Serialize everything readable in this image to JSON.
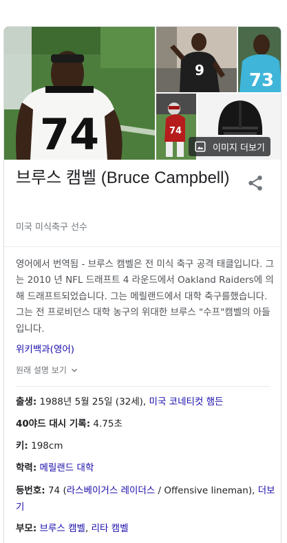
{
  "images": {
    "more_label": "이미지 더보기",
    "main_jersey": "74",
    "a_jersey": "9",
    "b_jersey": "73",
    "c_jersey": "74"
  },
  "header": {
    "title": "브루스 캠벨 (Bruce Campbell)",
    "subtitle": "미국 미식축구 선수"
  },
  "description": {
    "source_label": "영어에서 번역됨 - ",
    "text": "브루스 캠벨은 전 미식 축구 공격 태클입니다. 그는 2010 년 NFL 드래프트 4 라운드에서 Oakland Raiders에 의해 드래프트되었습니다. 그는 메릴랜드에서 대학 축구를했습니다. 그는 전 프로비던스 대학 농구의 위대한 브루스 \"수프\"캠벨의 아들입니다.",
    "wiki_link": "위키백과(영어)",
    "original_label": "원래 설명 보기"
  },
  "facts": {
    "born_label": "출생",
    "born_value": "1988년 5월 25일 (32세),",
    "born_place": "미국 코네티컷 햄든",
    "dash_label": "40야드 대시 기록",
    "dash_value": "4.75초",
    "height_label": "키",
    "height_value": "198cm",
    "edu_label": "학력",
    "edu_value": "메릴랜드 대학",
    "number_label": "등번호",
    "number_value": "74 (",
    "number_team": "라스베이거스 레이더스",
    "number_rest": " / Offensive lineman),",
    "number_more": "더보기",
    "parents_label": "부모",
    "parent1": "브루스 캠벨",
    "parent_sep": ", ",
    "parent2": "리타 캠벨"
  },
  "colors": {
    "link": "#1a0dab",
    "text": "#202124",
    "muted": "#70757a",
    "divider": "#ebebeb"
  }
}
